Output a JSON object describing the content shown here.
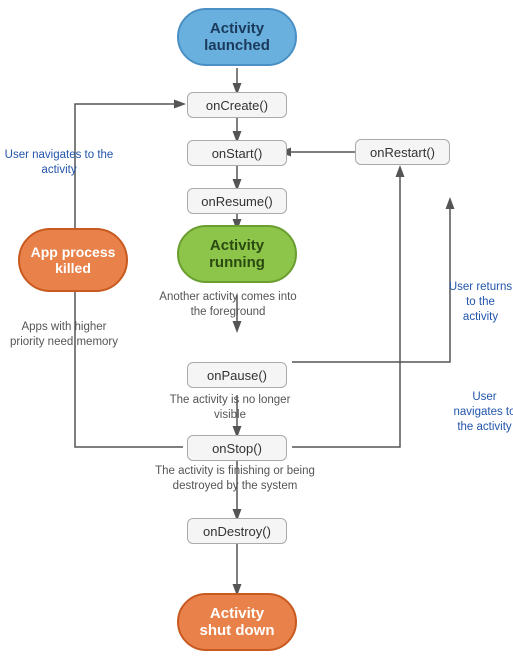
{
  "nodes": {
    "activity_launched": {
      "label": "Activity\nlaunched"
    },
    "on_create": {
      "label": "onCreate()"
    },
    "on_start": {
      "label": "onStart()"
    },
    "on_resume": {
      "label": "onResume()"
    },
    "activity_running": {
      "label": "Activity\nrunning"
    },
    "on_pause": {
      "label": "onPause()"
    },
    "on_stop": {
      "label": "onStop()"
    },
    "on_destroy": {
      "label": "onDestroy()"
    },
    "activity_shutdown": {
      "label": "Activity\nshut down"
    },
    "on_restart": {
      "label": "onRestart()"
    },
    "app_process_killed": {
      "label": "App process\nkilled"
    }
  },
  "labels": {
    "user_navigates_to": "User navigates\nto the activity",
    "another_activity": "Another activity comes\ninto the foreground",
    "apps_higher_priority": "Apps with higher priority\nneed memory",
    "activity_no_longer": "The activity is\nno longer visible",
    "activity_finishing": "The activity is finishing or\nbeing destroyed by the system",
    "user_returns": "User returns\nto the activity",
    "user_navigates_to2": "User navigates\nto the activity"
  }
}
